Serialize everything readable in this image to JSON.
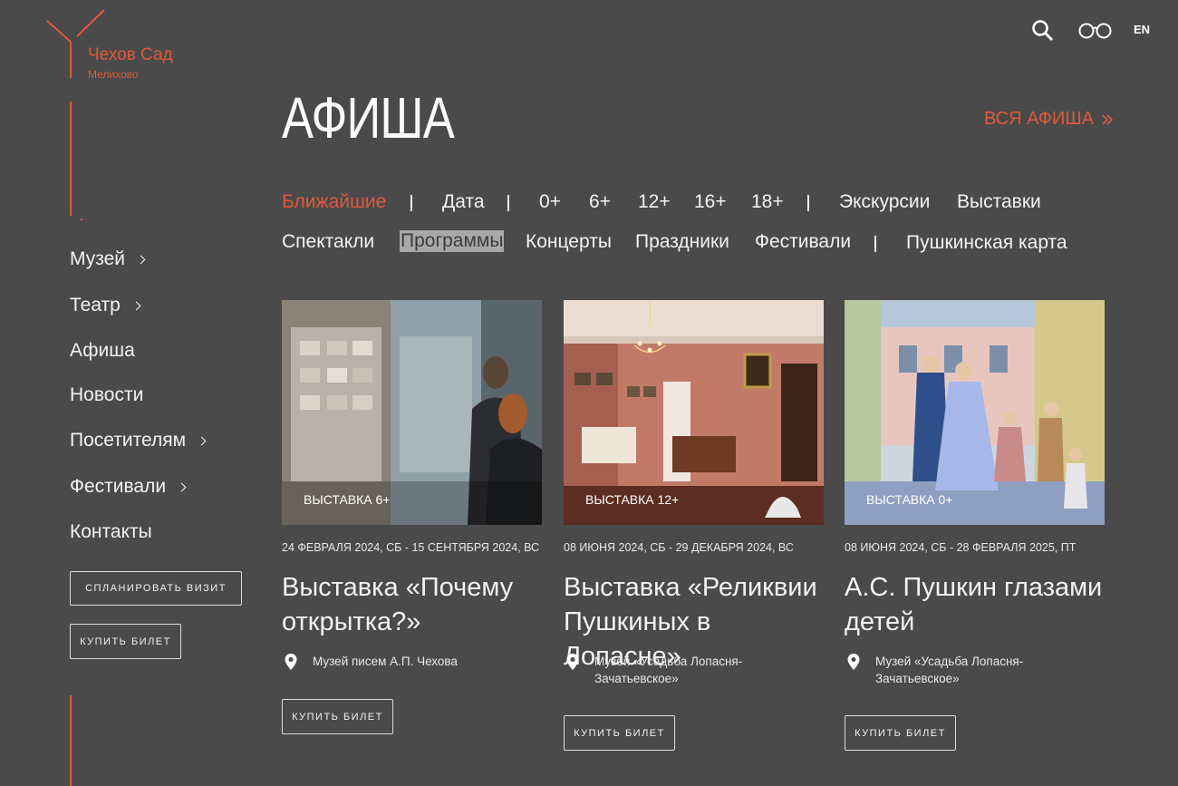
{
  "logo": {
    "title": "Чехов Сад",
    "subtitle": "Мелихово"
  },
  "header": {
    "search_icon": "search-icon",
    "glasses_icon": "glasses-icon",
    "lang": "EN"
  },
  "side_menu": [
    {
      "label": "Музей",
      "has_submenu": true
    },
    {
      "label": "Театр",
      "has_submenu": true
    },
    {
      "label": "Афиша",
      "has_submenu": false
    },
    {
      "label": "Новости",
      "has_submenu": false
    },
    {
      "label": "Посетителям",
      "has_submenu": true
    },
    {
      "label": "Фестивали",
      "has_submenu": true
    },
    {
      "label": "Контакты",
      "has_submenu": false
    }
  ],
  "side_buttons": {
    "plan_visit": "СПЛАНИРОВАТЬ ВИЗИТ",
    "buy_ticket": "КУПИТЬ БИЛЕТ"
  },
  "main": {
    "title": "АФИША",
    "all_link": "ВСЯ АФИША",
    "filters_row1": [
      "Ближайшие",
      "Дата",
      "0+",
      "6+",
      "12+",
      "16+",
      "18+",
      "Экскурсии",
      "Выставки"
    ],
    "filters_row2": [
      "Спектакли",
      "Программы",
      "Концерты",
      "Праздники",
      "Фестивали",
      "Пушкинская карта"
    ],
    "active_filter": "Ближайшие",
    "highlighted_filter": "Программы"
  },
  "cards": [
    {
      "badge": "ВЫСТАВКА  6+",
      "date": "24 ФЕВРАЛЯ 2024, СБ - 15 СЕНТЯБРЯ 2024, ВС",
      "title": "Выставка «Почему открытка?»",
      "place": "Музей писем А.П. Чехова",
      "button": "КУПИТЬ БИЛЕТ"
    },
    {
      "badge": "ВЫСТАВКА  12+",
      "date": "08 ИЮНЯ 2024, СБ - 29 ДЕКАБРЯ 2024, ВС",
      "title": "Выставка «Реликвии Пушкиных в Лопасне»",
      "place": "Музей «Усадьба Лопасня-Зачатьевское»",
      "button": "КУПИТЬ БИЛЕТ"
    },
    {
      "badge": "ВЫСТАВКА  0+",
      "date": "08 ИЮНЯ 2024, СБ - 28 ФЕВРАЛЯ 2025, ПТ",
      "title": "А.С. Пушкин глазами детей",
      "place": "Музей «Усадьба Лопасня-Зачатьевское»",
      "button": "КУПИТЬ БИЛЕТ"
    }
  ],
  "colors": {
    "background": "#4a4a4a",
    "accent": "#e0583a",
    "text": "#f2f2f2"
  }
}
